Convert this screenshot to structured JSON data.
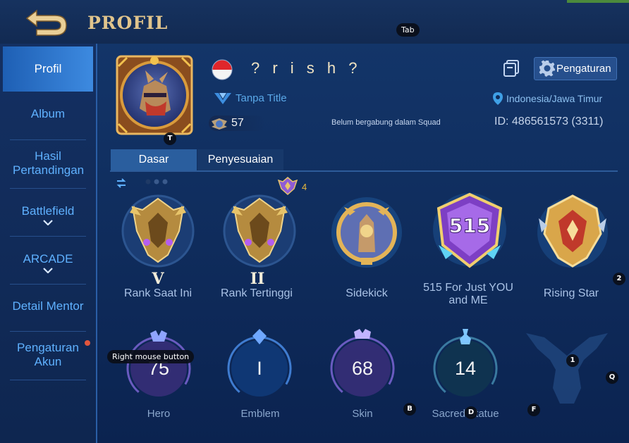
{
  "header": {
    "title": "PROFIL"
  },
  "hints": {
    "tab": "Tab",
    "avatar_key": "T",
    "right_mouse": "Right mouse button",
    "key_2": "2",
    "key_1": "1",
    "key_q": "Q",
    "key_b": "B",
    "key_d": "D",
    "key_f": "F"
  },
  "sidebar": {
    "items": [
      {
        "label": "Profil",
        "active": true
      },
      {
        "label": "Album"
      },
      {
        "label": "Hasil Pertandingan"
      },
      {
        "label": "Battlefield"
      },
      {
        "label": "ARCADE"
      },
      {
        "label": "Detail Mentor"
      },
      {
        "label": "Pengaturan Akun"
      }
    ]
  },
  "profile": {
    "name": "? r i s h ?",
    "title": "Tanpa Title",
    "level": "57",
    "squad": "Belum bergabung dalam Squad",
    "location": "Indonesia/Jawa Timur",
    "id": "ID: 486561573 (3311)",
    "settings_label": "Pengaturan"
  },
  "tabs": [
    {
      "label": "Dasar",
      "active": true
    },
    {
      "label": "Penyesuaian"
    }
  ],
  "mythic_count": "4",
  "achievements": [
    {
      "label": "Rank Saat Ini",
      "numeral": "V"
    },
    {
      "label": "Rank Tertinggi",
      "numeral": "II"
    },
    {
      "label": "Sidekick"
    },
    {
      "label": "515 For Just YOU and ME",
      "emblem_text": "515"
    },
    {
      "label": "Rising Star"
    }
  ],
  "stats": [
    {
      "label": "Hero",
      "value": "75"
    },
    {
      "label": "Emblem",
      "value": "I"
    },
    {
      "label": "Skin",
      "value": "68"
    },
    {
      "label": "Sacred Statue",
      "value": "14"
    }
  ],
  "colors": {
    "accent_blue": "#5fb1ff",
    "gold": "#e0c48c",
    "active_tab": "#2a5e9e",
    "notification": "#e2553d"
  }
}
